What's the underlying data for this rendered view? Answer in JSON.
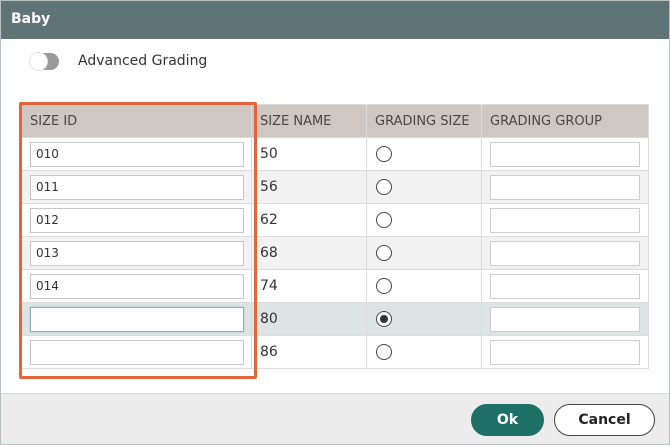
{
  "dialog": {
    "title": "Baby"
  },
  "advanced_grading": {
    "label": "Advanced Grading",
    "enabled": false
  },
  "table": {
    "headers": [
      "SIZE ID",
      "SIZE NAME",
      "GRADING SIZE",
      "GRADING GROUP"
    ],
    "rows": [
      {
        "size_id": "010",
        "size_name": "50",
        "grading_size": false,
        "grading_group": ""
      },
      {
        "size_id": "011",
        "size_name": "56",
        "grading_size": false,
        "grading_group": ""
      },
      {
        "size_id": "012",
        "size_name": "62",
        "grading_size": false,
        "grading_group": ""
      },
      {
        "size_id": "013",
        "size_name": "68",
        "grading_size": false,
        "grading_group": ""
      },
      {
        "size_id": "014",
        "size_name": "74",
        "grading_size": false,
        "grading_group": ""
      },
      {
        "size_id": "",
        "size_name": "80",
        "grading_size": true,
        "grading_group": ""
      },
      {
        "size_id": "",
        "size_name": "86",
        "grading_size": false,
        "grading_group": ""
      }
    ]
  },
  "footer": {
    "ok_label": "Ok",
    "cancel_label": "Cancel"
  },
  "colors": {
    "titlebar": "#5e7477",
    "header_bg": "#cfc7c1",
    "highlight": "#e4643b",
    "ok_button": "#1e6f66"
  }
}
